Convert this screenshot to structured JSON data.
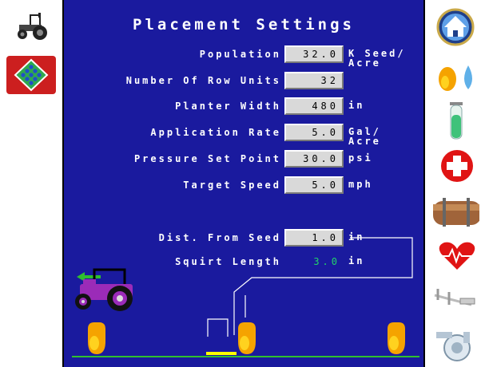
{
  "title": "Placement Settings",
  "fields": {
    "population": {
      "label": "Population",
      "value": "32.0",
      "unit_line1": "K Seed/",
      "unit_line2": "Acre"
    },
    "row_units": {
      "label": "Number Of Row Units",
      "value": "32"
    },
    "planter_width": {
      "label": "Planter Width",
      "value": "480",
      "unit": "in"
    },
    "application_rate": {
      "label": "Application Rate",
      "value": "5.0",
      "unit_line1": "Gal/",
      "unit_line2": "Acre"
    },
    "pressure_set_point": {
      "label": "Pressure Set Point",
      "value": "30.0",
      "unit": "psi"
    },
    "target_speed": {
      "label": "Target Speed",
      "value": "5.0",
      "unit": "mph"
    },
    "dist_from_seed": {
      "label": "Dist. From Seed",
      "value": "1.0",
      "unit": "in"
    },
    "squirt_length": {
      "label": "Squirt Length",
      "value": "3.0",
      "unit": "in"
    }
  },
  "colors": {
    "panel_bg": "#1a1a9e",
    "field_bg": "#d9d9d9",
    "readonly_value": "#22d36a",
    "ground_line": "#2fbf2f",
    "seed_orange": "#f5a300",
    "squirt_marker": "#ffff00"
  },
  "left_nav": [
    {
      "name": "tractor-icon"
    },
    {
      "name": "diamond-grid-icon",
      "selected": true,
      "color": "#cc1f1f"
    }
  ],
  "right_nav": [
    {
      "name": "home-icon"
    },
    {
      "name": "seed-droplet-icon"
    },
    {
      "name": "test-tube-icon"
    },
    {
      "name": "medical-cross-icon"
    },
    {
      "name": "tank-icon"
    },
    {
      "name": "heart-rate-icon"
    },
    {
      "name": "caliper-icon"
    },
    {
      "name": "pump-icon"
    }
  ]
}
